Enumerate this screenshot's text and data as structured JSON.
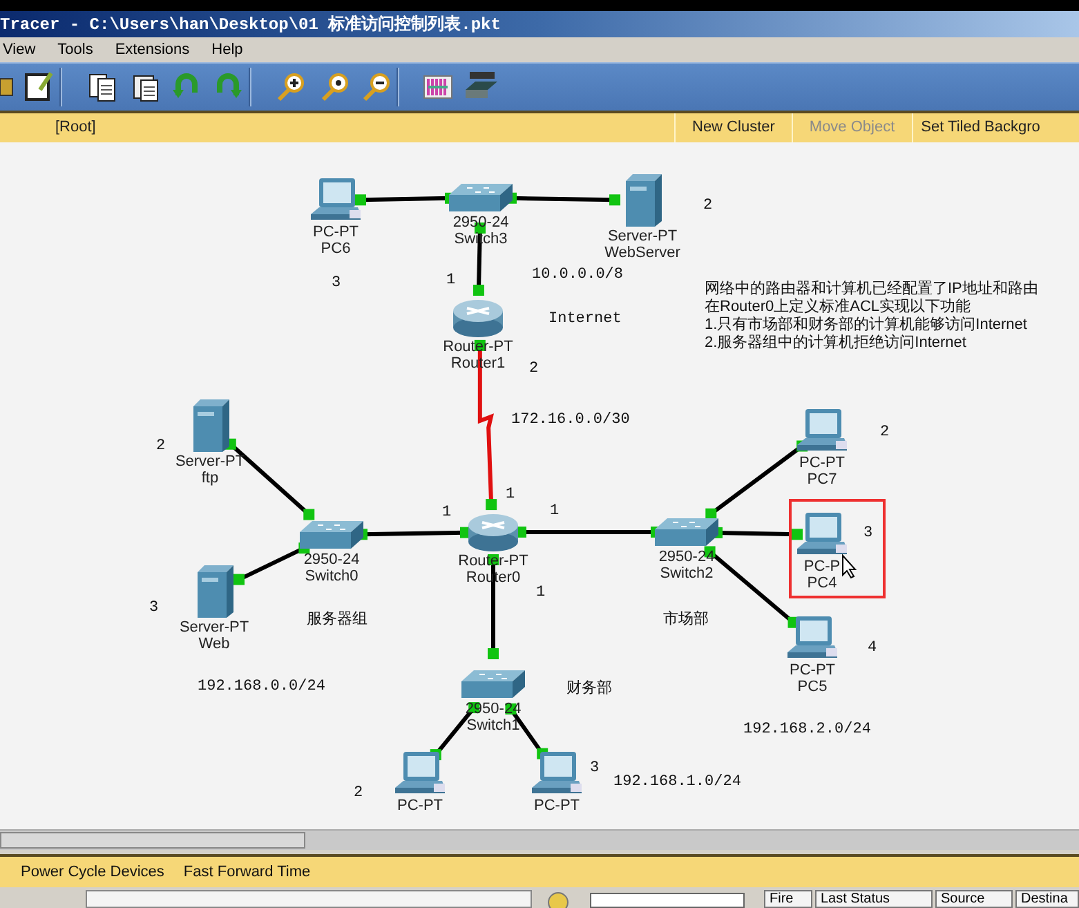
{
  "window": {
    "title": "Tracer - C:\\Users\\han\\Desktop\\01 标准访问控制列表.pkt"
  },
  "menu": [
    "View",
    "Tools",
    "Extensions",
    "Help"
  ],
  "workspace_bar": {
    "path": "[Root]",
    "buttons": [
      {
        "label": "New Cluster",
        "disabled": false
      },
      {
        "label": "Move Object",
        "disabled": true
      },
      {
        "label": "Set Tiled Backgro",
        "disabled": false
      }
    ]
  },
  "topology": {
    "nodes": [
      {
        "kind": "pc",
        "model": "PC-PT",
        "name": "PC6",
        "selected": false
      },
      {
        "kind": "switch",
        "model": "2950-24",
        "name": "Switch3",
        "selected": false
      },
      {
        "kind": "server",
        "model": "Server-PT",
        "name": "WebServer",
        "selected": false
      },
      {
        "kind": "router",
        "model": "Router-PT",
        "name": "Router1",
        "selected": false
      },
      {
        "kind": "server",
        "model": "Server-PT",
        "name": "ftp",
        "selected": false
      },
      {
        "kind": "server",
        "model": "Server-PT",
        "name": "Web",
        "selected": false
      },
      {
        "kind": "switch",
        "model": "2950-24",
        "name": "Switch0",
        "selected": false
      },
      {
        "kind": "router",
        "model": "Router-PT",
        "name": "Router0",
        "selected": false
      },
      {
        "kind": "switch",
        "model": "2950-24",
        "name": "Switch2",
        "selected": false
      },
      {
        "kind": "pc",
        "model": "PC-PT",
        "name": "PC7",
        "selected": false
      },
      {
        "kind": "pc",
        "model": "PC-P",
        "name": "PC4",
        "selected": true
      },
      {
        "kind": "pc",
        "model": "PC-PT",
        "name": "PC5",
        "selected": false
      },
      {
        "kind": "switch",
        "model": "2950-24",
        "name": "Switch1",
        "selected": false
      },
      {
        "kind": "pc",
        "model": "PC-PT",
        "selected": false
      },
      {
        "kind": "pc",
        "model": "PC-PT",
        "selected": false
      }
    ],
    "links": [
      {
        "kind": "copper"
      },
      {
        "kind": "copper"
      },
      {
        "kind": "copper"
      },
      {
        "kind": "serial"
      },
      {
        "kind": "copper"
      },
      {
        "kind": "copper"
      },
      {
        "kind": "copper"
      },
      {
        "kind": "copper"
      },
      {
        "kind": "copper"
      },
      {
        "kind": "copper"
      },
      {
        "kind": "copper"
      },
      {
        "kind": "copper"
      },
      {
        "kind": "copper"
      },
      {
        "kind": "copper"
      }
    ],
    "labels": [
      {
        "text": "2"
      },
      {
        "text": "3"
      },
      {
        "text": "1"
      },
      {
        "text": "10.0.0.0/8"
      },
      {
        "text": "Internet"
      },
      {
        "text": "2"
      },
      {
        "text": "172.16.0.0/30"
      },
      {
        "text": "2"
      },
      {
        "text": "2"
      },
      {
        "text": "1"
      },
      {
        "text": "1"
      },
      {
        "text": "1"
      },
      {
        "text": "3"
      },
      {
        "text": "3"
      },
      {
        "text": "1"
      },
      {
        "text": "服务器组"
      },
      {
        "text": "市场部"
      },
      {
        "text": "4"
      },
      {
        "text": "192.168.0.0/24"
      },
      {
        "text": "财务部"
      },
      {
        "text": "192.168.2.0/24"
      },
      {
        "text": "3"
      },
      {
        "text": "192.168.1.0/24"
      },
      {
        "text": "2"
      }
    ],
    "note": [
      "网络中的路由器和计算机已经配置了IP地址和路由",
      "在Router0上定义标准ACL实现以下功能",
      "1.只有市场部和财务部的计算机能够访问Internet",
      "2.服务器组中的计算机拒绝访问Internet"
    ]
  },
  "realtime_bar": {
    "buttons": [
      "Power Cycle Devices",
      "Fast Forward Time"
    ]
  },
  "pdu_table": {
    "columns": [
      "Fire",
      "Last Status",
      "Source",
      "Destina"
    ]
  }
}
